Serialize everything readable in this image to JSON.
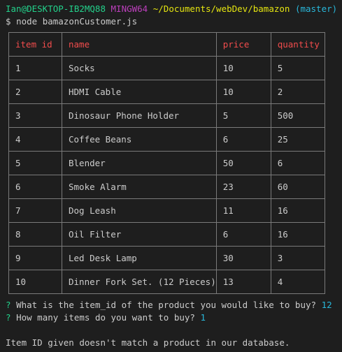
{
  "prompt": {
    "user_host": "Ian@DESKTOP-IB2MQ88",
    "shell": "MINGW64",
    "path": "~/Documents/webDev/bamazon",
    "branch": "(master)",
    "symbol": "$",
    "command": "node bamazonCustomer.js"
  },
  "table": {
    "headers": [
      "item id",
      "name",
      "price",
      "quantity"
    ],
    "rows": [
      [
        "1",
        "Socks",
        "10",
        "5"
      ],
      [
        "2",
        "HDMI Cable",
        "10",
        "2"
      ],
      [
        "3",
        "Dinosaur Phone Holder",
        "5",
        "500"
      ],
      [
        "4",
        "Coffee Beans",
        "6",
        "25"
      ],
      [
        "5",
        "Blender",
        "50",
        "6"
      ],
      [
        "6",
        "Smoke Alarm",
        "23",
        "60"
      ],
      [
        "7",
        "Dog Leash",
        "11",
        "16"
      ],
      [
        "8",
        "Oil Filter",
        "6",
        "16"
      ],
      [
        "9",
        "Led Desk Lamp",
        "30",
        "3"
      ],
      [
        "10",
        "Dinner Fork Set. (12 Pieces)",
        "13",
        "4"
      ]
    ]
  },
  "questions": [
    {
      "mark": "?",
      "text": "What is the item_id of the product you would like to buy?",
      "answer": "12"
    },
    {
      "mark": "?",
      "text": "How many items do you want to buy?",
      "answer": "1"
    }
  ],
  "message": "Item ID given doesn't match a product in our database.",
  "colors": {
    "background": "#1e1e1e",
    "green": "#23d18b",
    "magenta": "#bc3fbc",
    "yellow": "#e5e510",
    "cyan": "#29b8db",
    "red": "#f14c4c",
    "text": "#cccccc"
  }
}
